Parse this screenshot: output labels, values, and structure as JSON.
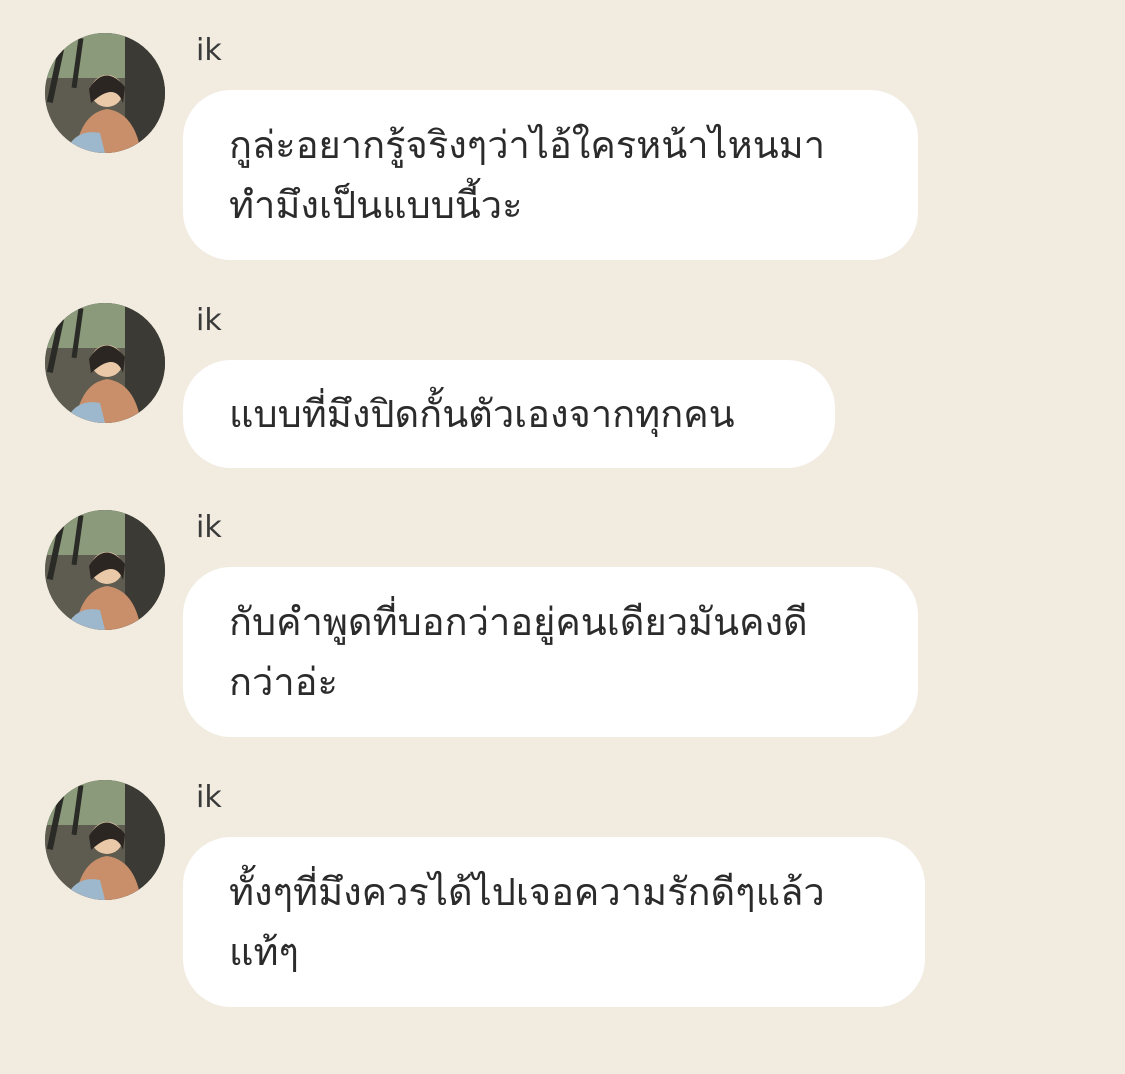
{
  "colors": {
    "background": "#f1ebe0",
    "bubble": "#ffffff",
    "text": "#2b2b2b"
  },
  "messages": [
    {
      "sender": "ik",
      "avatar_icon": "profile-photo",
      "text": "กูล่ะอยากรู้จริงๆว่าไอ้ใครหน้าไหนมา\nทำมึงเป็นแบบนี้วะ"
    },
    {
      "sender": "ik",
      "avatar_icon": "profile-photo",
      "text": "แบบที่มึงปิดกั้นตัวเองจากทุกคน"
    },
    {
      "sender": "ik",
      "avatar_icon": "profile-photo",
      "text": "กับคำพูดที่บอกว่าอยู่คนเดียวมันคงดี\nกว่าอ่ะ"
    },
    {
      "sender": "ik",
      "avatar_icon": "profile-photo",
      "text": "ทั้งๆที่มึงควรได้ไปเจอความรักดีๆแล้ว\nแท้ๆ"
    }
  ]
}
